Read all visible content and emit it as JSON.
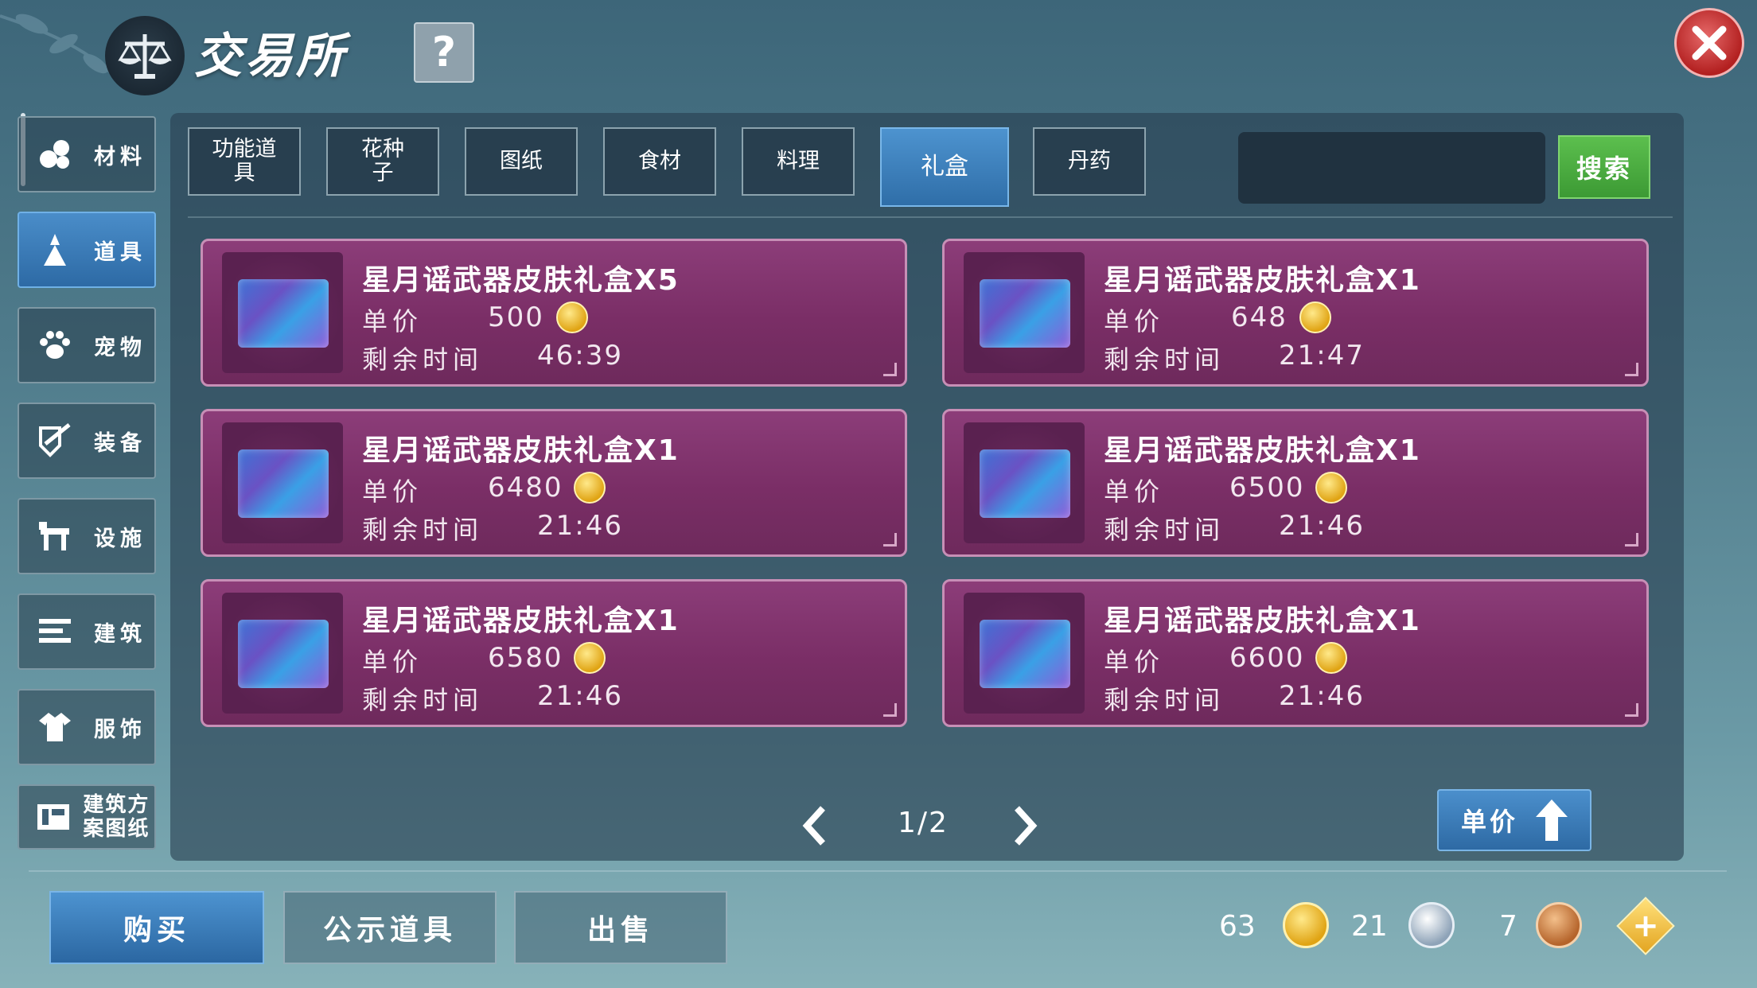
{
  "header": {
    "title": "交易所",
    "help_label": "?"
  },
  "sidebar": {
    "items": [
      {
        "label": "材料",
        "icon": "materials-icon",
        "active": false
      },
      {
        "label": "道具",
        "icon": "item-icon",
        "active": true
      },
      {
        "label": "宠物",
        "icon": "paw-icon",
        "active": false
      },
      {
        "label": "装备",
        "icon": "equipment-icon",
        "active": false
      },
      {
        "label": "设施",
        "icon": "facility-icon",
        "active": false
      },
      {
        "label": "建筑",
        "icon": "building-icon",
        "active": false
      },
      {
        "label": "服饰",
        "icon": "clothing-icon",
        "active": false
      },
      {
        "label": "建筑方案图纸",
        "icon": "blueprint-icon",
        "active": false
      }
    ]
  },
  "tabs": [
    {
      "label": "功能道具",
      "active": false
    },
    {
      "label": "花种子",
      "active": false
    },
    {
      "label": "图纸",
      "active": false
    },
    {
      "label": "食材",
      "active": false
    },
    {
      "label": "料理",
      "active": false
    },
    {
      "label": "礼盒",
      "active": true
    },
    {
      "label": "丹药",
      "active": false
    }
  ],
  "search": {
    "value": "",
    "placeholder": "",
    "button_label": "搜索"
  },
  "labels": {
    "unit_price": "单价",
    "remaining_time": "剩余时间"
  },
  "listings": [
    {
      "name": "星月谣武器皮肤礼盒X5",
      "price": "500",
      "time": "46:39"
    },
    {
      "name": "星月谣武器皮肤礼盒X1",
      "price": "648",
      "time": "21:47"
    },
    {
      "name": "星月谣武器皮肤礼盒X1",
      "price": "6480",
      "time": "21:46"
    },
    {
      "name": "星月谣武器皮肤礼盒X1",
      "price": "6500",
      "time": "21:46"
    },
    {
      "name": "星月谣武器皮肤礼盒X1",
      "price": "6580",
      "time": "21:46"
    },
    {
      "name": "星月谣武器皮肤礼盒X1",
      "price": "6600",
      "time": "21:46"
    }
  ],
  "pagination": {
    "current": "1/2"
  },
  "sort": {
    "label": "单价",
    "direction": "up"
  },
  "actions": {
    "buy": "购买",
    "showcase": "公示道具",
    "sell": "出售"
  },
  "currency": {
    "gold": "63",
    "silver": "21",
    "copper": "7"
  },
  "colors": {
    "card_bg": "#7a2e66",
    "accent_blue": "#2f6ea8",
    "search_green": "#3c9a34",
    "close_red": "#b32020"
  }
}
